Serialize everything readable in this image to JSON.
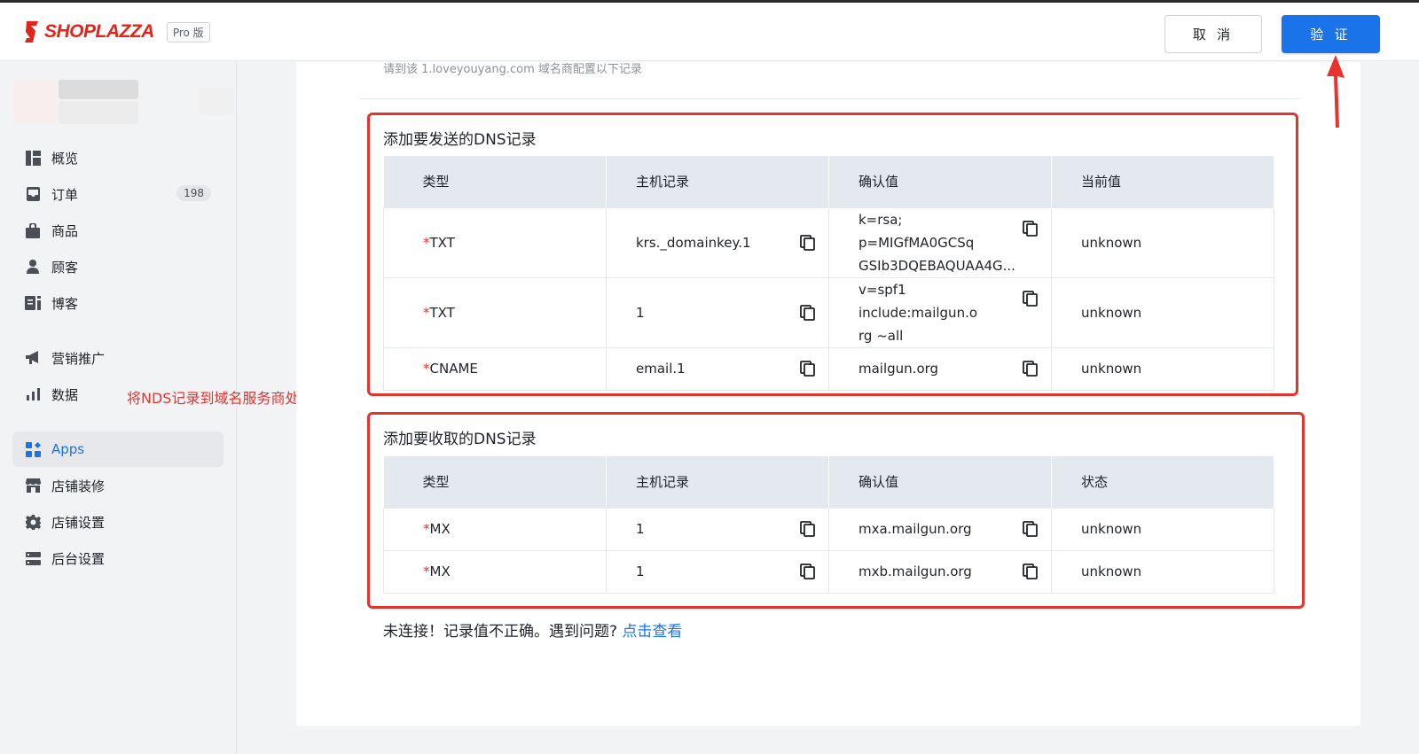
{
  "header": {
    "logo_text": "SHOPLAZZA",
    "plan_badge": "Pro 版",
    "cancel_label": "取 消",
    "verify_label": "验 证"
  },
  "sidebar": {
    "items": [
      {
        "label": "概览",
        "icon": "dashboard-icon"
      },
      {
        "label": "订单",
        "icon": "inbox-icon",
        "count": "198"
      },
      {
        "label": "商品",
        "icon": "bag-icon"
      },
      {
        "label": "顾客",
        "icon": "person-icon"
      },
      {
        "label": "博客",
        "icon": "blog-icon"
      },
      {
        "label": "营销推广",
        "icon": "megaphone-icon"
      },
      {
        "label": "数据",
        "icon": "bar-chart-icon"
      },
      {
        "label": "Apps",
        "icon": "apps-icon",
        "active": true
      },
      {
        "label": "店铺装修",
        "icon": "store-icon"
      },
      {
        "label": "店铺设置",
        "icon": "gear-icon"
      },
      {
        "label": "后台设置",
        "icon": "server-icon"
      }
    ]
  },
  "annotation": {
    "text": "将NDS记录到域名服务商处解析",
    "color": "#e8322d"
  },
  "main": {
    "hint": "请到该 1.loveyouyang.com 域名商配置以下记录",
    "send_section": {
      "title": "添加要发送的DNS记录",
      "headers": [
        "类型",
        "主机记录",
        "确认值",
        "当前值"
      ],
      "rows": [
        {
          "type": "TXT",
          "host": "krs._domainkey.1",
          "value": "k=rsa; p=MIGfMA0GCSqGSIb3DQEBAQUAA4G...",
          "value_line1": "k=rsa; p=MIGfMA0GCSq",
          "value_line2": "GSIb3DQEBAQUAA4G...",
          "current": "unknown"
        },
        {
          "type": "TXT",
          "host": "1",
          "value": "v=spf1 include:mailgun.org ~all",
          "value_line1": "v=spf1 include:mailgun.o",
          "value_line2": "rg ~all",
          "current": "unknown"
        },
        {
          "type": "CNAME",
          "host": "email.1",
          "value": "mailgun.org",
          "current": "unknown"
        }
      ]
    },
    "receive_section": {
      "title": "添加要收取的DNS记录",
      "headers": [
        "类型",
        "主机记录",
        "确认值",
        "状态"
      ],
      "rows": [
        {
          "type": "MX",
          "host": "1",
          "value": "mxa.mailgun.org",
          "current": "unknown"
        },
        {
          "type": "MX",
          "host": "1",
          "value": "mxb.mailgun.org",
          "current": "unknown"
        }
      ]
    },
    "status_text": "未连接！记录值不正确。遇到问题?",
    "status_link": "点击查看"
  },
  "colors": {
    "accent": "#1a73e8",
    "brand": "#e1251b",
    "error": "#e8322d"
  }
}
